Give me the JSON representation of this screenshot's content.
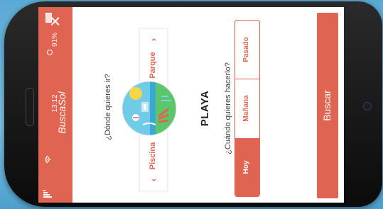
{
  "status": {
    "time": "13:12",
    "battery": "91%"
  },
  "app": {
    "title": "BuscaSol"
  },
  "where": {
    "question": "¿Dónde quieres ir?",
    "prev_option": "Piscina",
    "next_option": "Parque",
    "selected_place": "PLAYA"
  },
  "when": {
    "question": "¿Cuándo quieres hacerlo?",
    "options": [
      "Hoy",
      "Mañana",
      "Pasado"
    ],
    "selected_index": 0
  },
  "actions": {
    "search_label": "Buscar"
  },
  "colors": {
    "accent": "#e06452",
    "status_bar": "#e06452",
    "sky": "#6fcbe6",
    "grass": "#5cc66a",
    "sun": "#f3d649"
  },
  "icons": {
    "close": "close-icon",
    "wifi": "wifi-icon",
    "signal": "signal-icon",
    "battery": "battery-icon",
    "alarm": "alarm-icon",
    "chevron_prev": "chevron-down-icon",
    "chevron_next": "chevron-up-icon"
  }
}
